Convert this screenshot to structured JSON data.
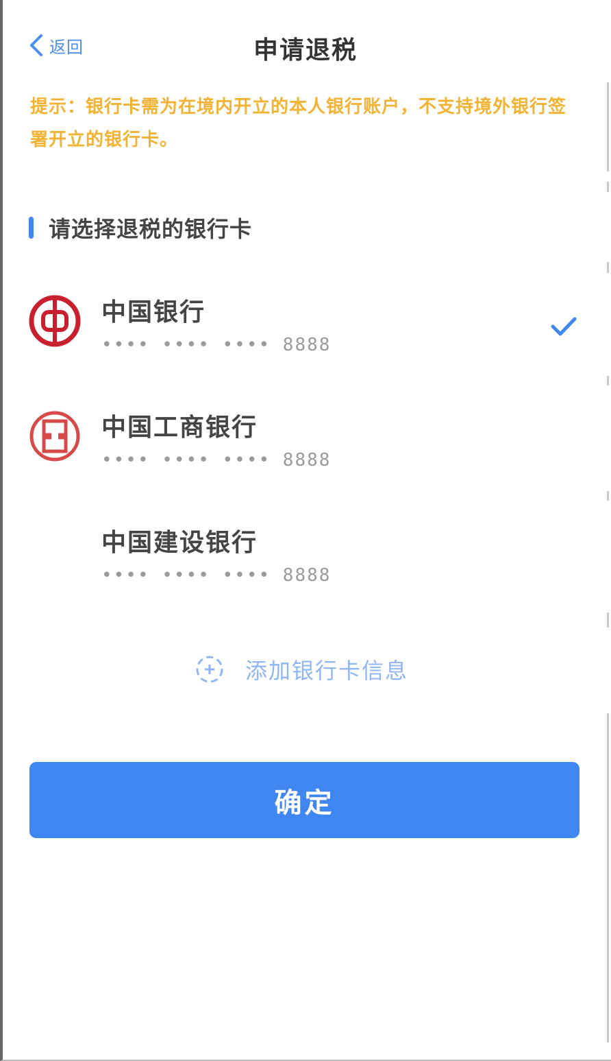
{
  "header": {
    "back_label": "返回",
    "title": "申请退税"
  },
  "notice": {
    "text": "提示：银行卡需为在境内开立的本人银行账户，不支持境外银行签署开立的银行卡。"
  },
  "section": {
    "title": "请选择退税的银行卡"
  },
  "banks": [
    {
      "name": "中国银行",
      "number": "•••• •••• •••• 8888",
      "logo": "boc-logo-icon",
      "selected": true
    },
    {
      "name": "中国工商银行",
      "number": "•••• •••• •••• 8888",
      "logo": "icbc-logo-icon",
      "selected": false
    },
    {
      "name": "中国建设银行",
      "number": "•••• •••• •••• 8888",
      "logo": "",
      "selected": false
    }
  ],
  "add_bank": {
    "label": "添加银行卡信息",
    "icon": "plus-circle-icon"
  },
  "confirm": {
    "label": "确定"
  },
  "colors": {
    "accent": "#3f86f0",
    "notice": "#f2b233",
    "bank_logo": "#c8202e"
  }
}
